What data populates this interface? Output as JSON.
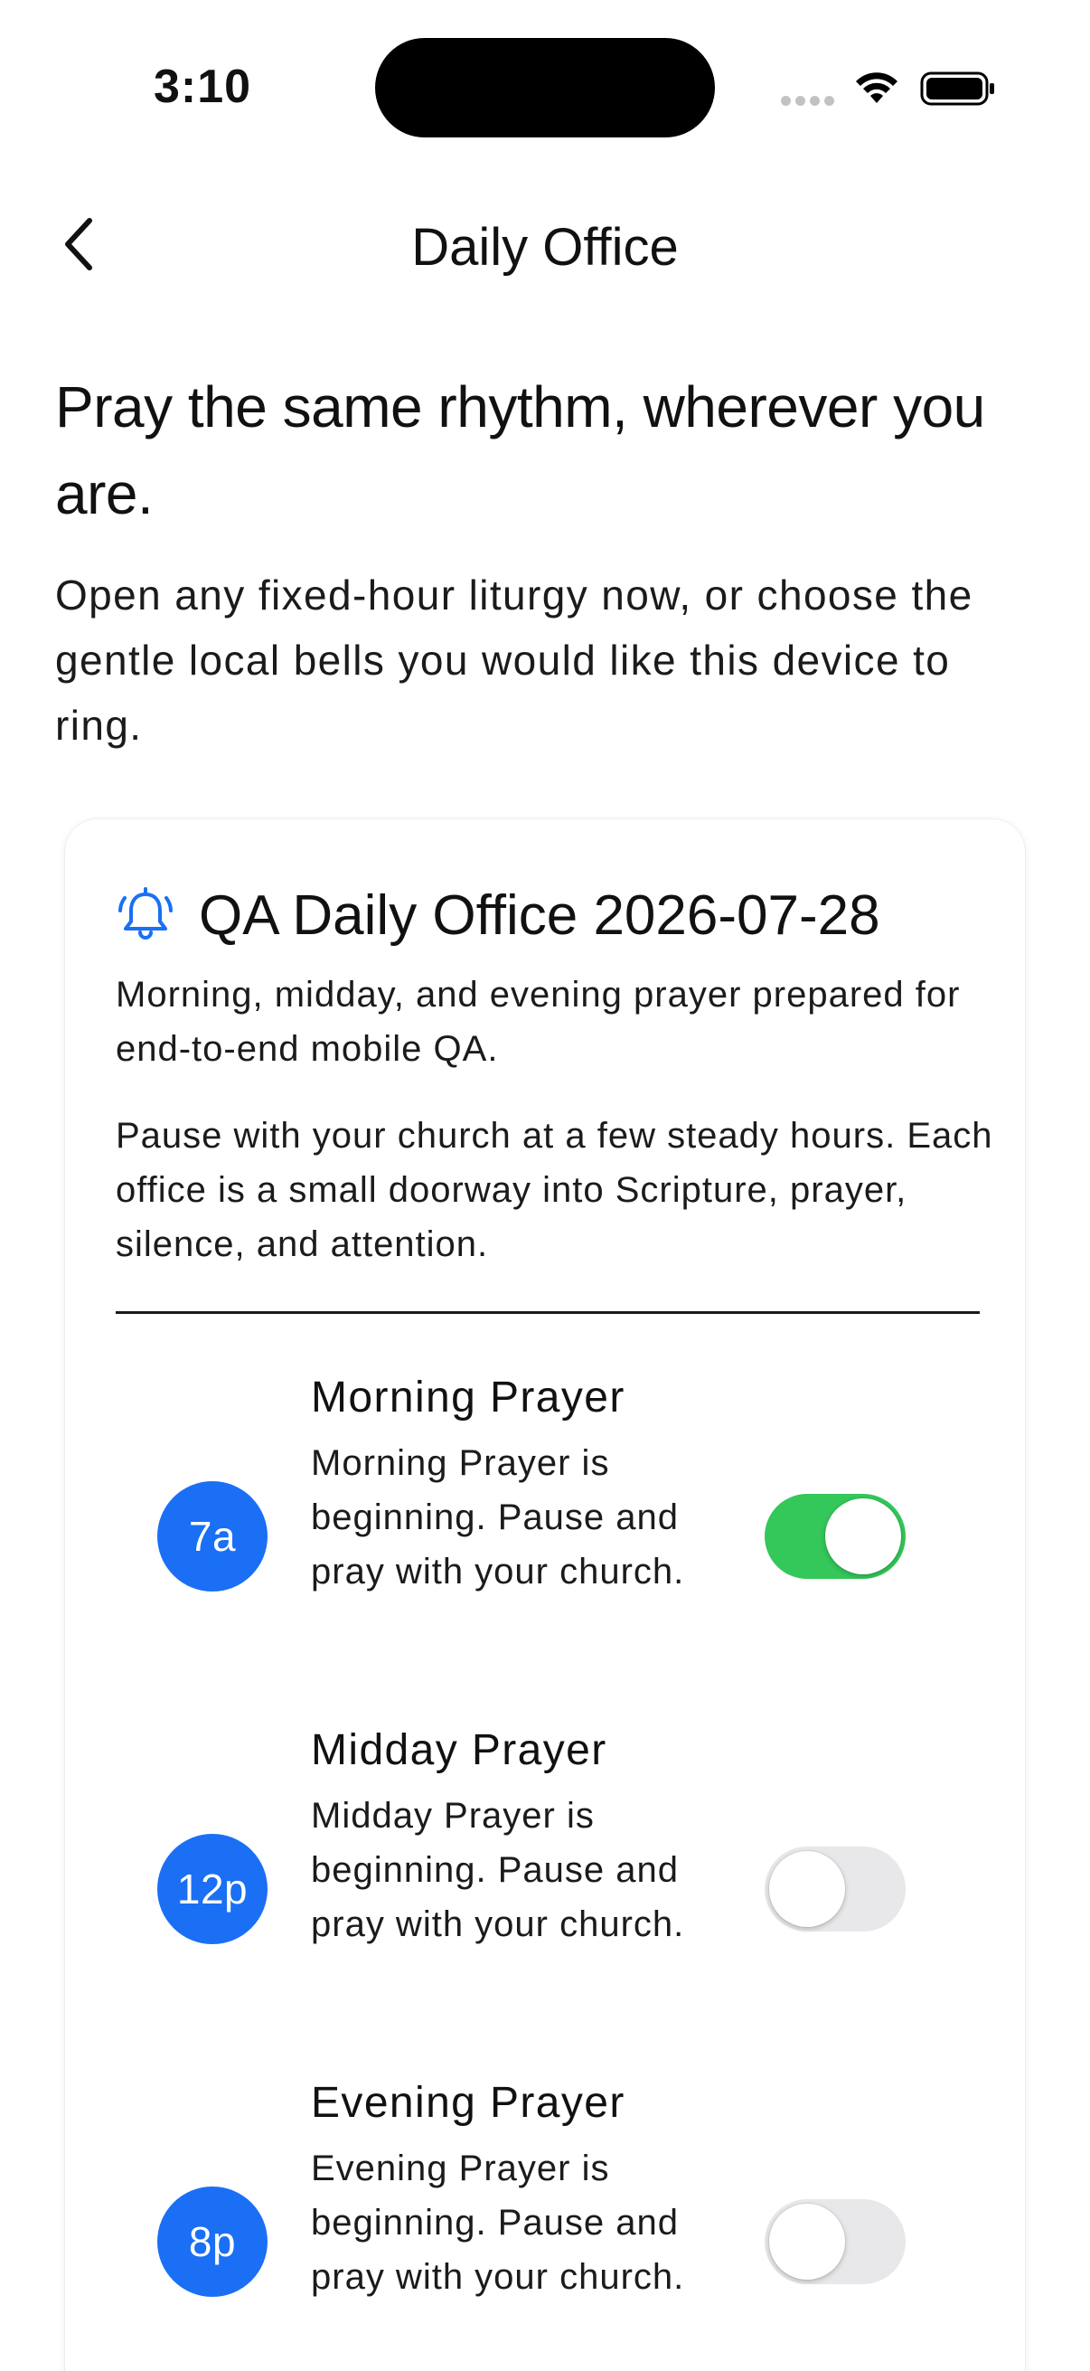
{
  "status_bar": {
    "time": "3:10"
  },
  "nav": {
    "title": "Daily Office",
    "back_icon": "chevron-left-icon"
  },
  "intro": {
    "heading": "Pray the same rhythm, wherever you are.",
    "body": "Open any fixed-hour liturgy now, or choose the gentle local bells you would like this device to ring."
  },
  "card": {
    "icon": "bell-ringing-icon",
    "title": "QA Daily Office 2026-07-28",
    "subtitle": "Morning, midday, and evening prayer prepared for end-to-end mobile QA.",
    "description": "Pause with your church at a few steady hours. Each office is a small doorway into Scripture, prayer, silence, and attention.",
    "offices": [
      {
        "hour": "7a",
        "name": "Morning Prayer",
        "message": "Morning Prayer is beginning. Pause and pray with your church.",
        "enabled": true
      },
      {
        "hour": "12p",
        "name": "Midday Prayer",
        "message": "Midday Prayer is beginning. Pause and pray with your church.",
        "enabled": false
      },
      {
        "hour": "8p",
        "name": "Evening Prayer",
        "message": "Evening Prayer is beginning. Pause and pray with your church.",
        "enabled": false
      }
    ]
  },
  "colors": {
    "accent": "#1a6ff5",
    "toggle_on": "#34c759",
    "toggle_off": "#e8e8ea"
  }
}
